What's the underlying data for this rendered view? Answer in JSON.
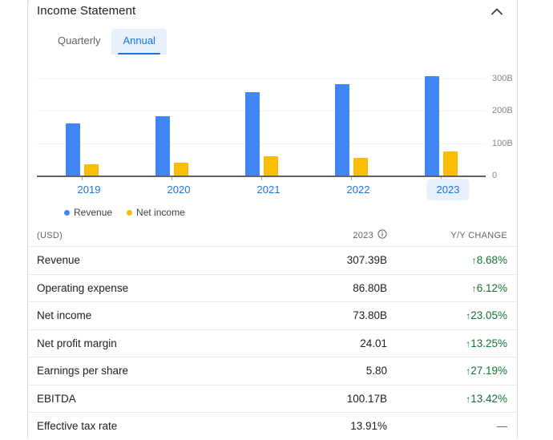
{
  "panel": {
    "title": "Income Statement",
    "collapse_icon": "chevron-up-icon"
  },
  "tabs": [
    {
      "label": "Quarterly",
      "active": false
    },
    {
      "label": "Annual",
      "active": true
    }
  ],
  "legend": [
    {
      "label": "Revenue",
      "color": "#4285f4"
    },
    {
      "label": "Net income",
      "color": "#fbbc04"
    }
  ],
  "chart_data": {
    "type": "bar",
    "title": "",
    "xlabel": "",
    "ylabel": "",
    "categories": [
      "2019",
      "2020",
      "2021",
      "2022",
      "2023"
    ],
    "selected_category": "2023",
    "series": [
      {
        "name": "Revenue",
        "color": "#4285f4",
        "values": [
          161.86,
          182.53,
          257.64,
          282.84,
          307.39
        ]
      },
      {
        "name": "Net income",
        "color": "#fbbc04",
        "values": [
          34.34,
          40.27,
          60.0,
          55.29,
          73.8
        ]
      }
    ],
    "ylim": [
      0,
      330
    ],
    "yticks": [
      0,
      100,
      200,
      300
    ],
    "ytick_labels": [
      "0",
      "100B",
      "200B",
      "300B"
    ],
    "grid": true,
    "legend_position": "bottom-left",
    "units": "USD billions"
  },
  "table": {
    "header": {
      "currency": "(USD)",
      "period": "2023",
      "info_icon": "info-icon",
      "change": "Y/Y CHANGE"
    },
    "rows": [
      {
        "label": "Revenue",
        "value": "307.39B",
        "change": "8.68%",
        "direction": "up"
      },
      {
        "label": "Operating expense",
        "value": "86.80B",
        "change": "6.12%",
        "direction": "up"
      },
      {
        "label": "Net income",
        "value": "73.80B",
        "change": "23.05%",
        "direction": "up"
      },
      {
        "label": "Net profit margin",
        "value": "24.01",
        "change": "13.25%",
        "direction": "up"
      },
      {
        "label": "Earnings per share",
        "value": "5.80",
        "change": "27.19%",
        "direction": "up"
      },
      {
        "label": "EBITDA",
        "value": "100.17B",
        "change": "13.42%",
        "direction": "up"
      },
      {
        "label": "Effective tax rate",
        "value": "13.91%",
        "change": "—",
        "direction": "flat"
      }
    ]
  }
}
